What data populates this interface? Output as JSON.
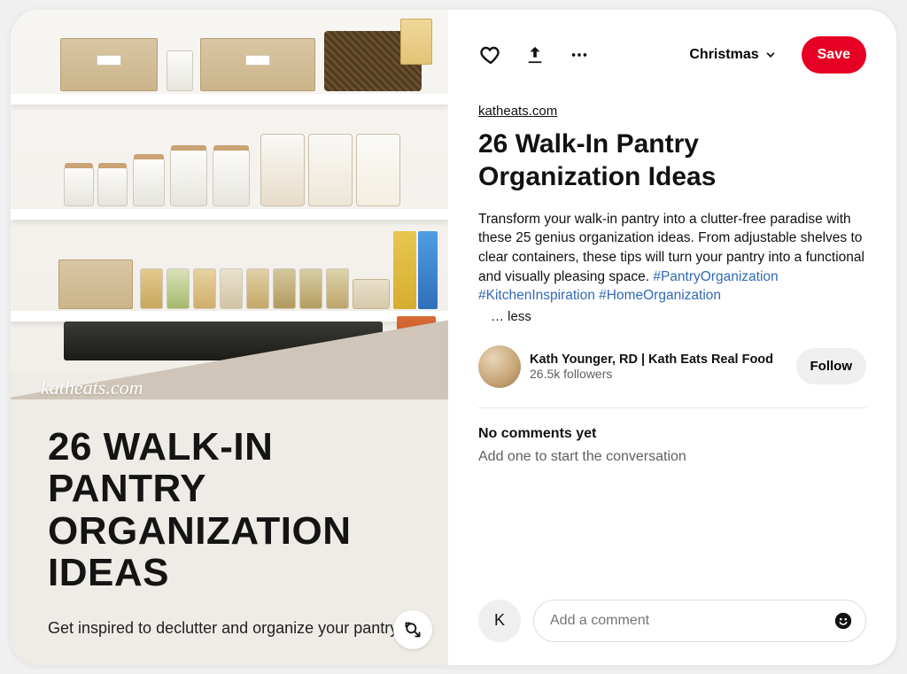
{
  "left_image": {
    "watermark": "katheats.com",
    "title_line1": "26 WALK-IN",
    "title_line2": "PANTRY",
    "title_line3": "ORGANIZATION",
    "title_line4": "IDEAS",
    "subtitle": "Get inspired to declutter and organize your pantry!"
  },
  "toolbar": {
    "board_label": "Christmas",
    "save_label": "Save"
  },
  "source_link": "katheats.com",
  "pin_title": "26 Walk-In Pantry Organization Ideas",
  "description_plain": "Transform your walk-in pantry into a clutter-free paradise with these 25 genius organization ideas. From adjustable shelves to clear containers, these tips will turn your pantry into a functional and visually pleasing space. ",
  "hashtags": [
    "#PantryOrganization",
    "#KitchenInspiration",
    "#HomeOrganization"
  ],
  "less_label": "… less",
  "author": {
    "name": "Kath Younger, RD | Kath Eats Real Food",
    "followers": "26.5k followers",
    "follow_label": "Follow"
  },
  "comments": {
    "none_label": "No comments yet",
    "prompt": "Add one to start the conversation",
    "me_initial": "K",
    "placeholder": "Add a comment"
  },
  "colors": {
    "save_red": "#e60023",
    "link_blue": "#3269b5"
  }
}
